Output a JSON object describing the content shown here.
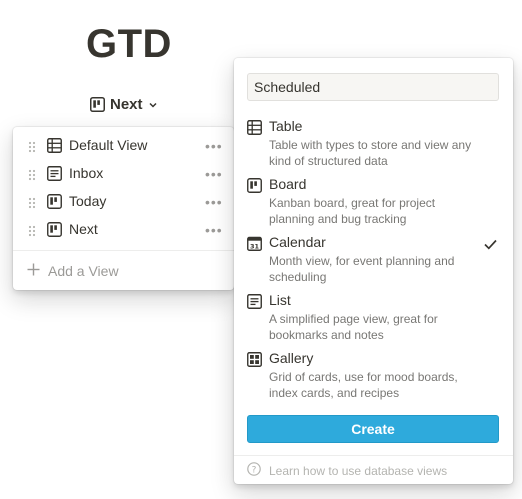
{
  "page": {
    "title": "GTD"
  },
  "view_switcher": {
    "label": "Next"
  },
  "views_menu": {
    "items": [
      {
        "label": "Default View",
        "icon": "table-icon"
      },
      {
        "label": "Inbox",
        "icon": "list-icon"
      },
      {
        "label": "Today",
        "icon": "board-icon"
      },
      {
        "label": "Next",
        "icon": "board-icon"
      }
    ],
    "add_label": "Add a View"
  },
  "create_menu": {
    "name_value": "Scheduled",
    "options": [
      {
        "name": "Table",
        "desc": "Table with types to store and view any kind of structured data",
        "icon": "table-icon",
        "selected": false
      },
      {
        "name": "Board",
        "desc": "Kanban board, great for project planning and bug tracking",
        "icon": "board-icon",
        "selected": false
      },
      {
        "name": "Calendar",
        "desc": "Month view, for event planning and scheduling",
        "icon": "calendar-icon",
        "selected": true
      },
      {
        "name": "List",
        "desc": "A simplified page view, great for bookmarks and notes",
        "icon": "list-icon",
        "selected": false
      },
      {
        "name": "Gallery",
        "desc": "Grid of cards, use for mood boards, index cards, and recipes",
        "icon": "gallery-icon",
        "selected": false
      }
    ],
    "create_label": "Create",
    "help_text": "Learn how to use database views"
  },
  "colors": {
    "text": "#37352f",
    "muted": "#787774",
    "create_button": "#2eaadc"
  }
}
